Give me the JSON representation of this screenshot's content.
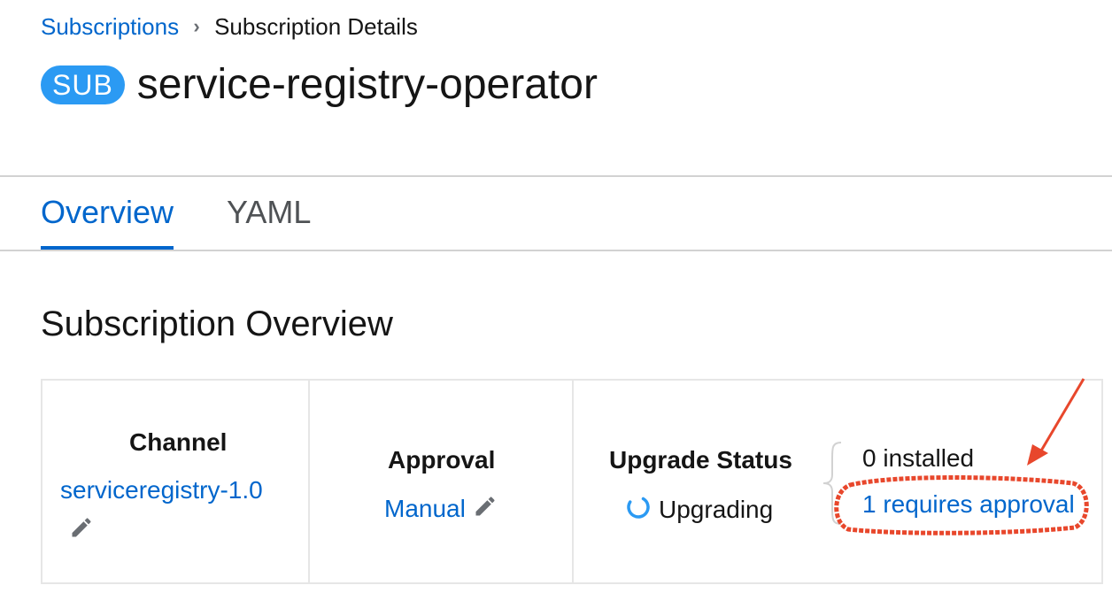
{
  "breadcrumb": {
    "parent": "Subscriptions",
    "current": "Subscription Details"
  },
  "header": {
    "badge": "SUB",
    "title": "service-registry-operator"
  },
  "tabs": [
    {
      "label": "Overview",
      "active": true
    },
    {
      "label": "YAML",
      "active": false
    }
  ],
  "section": {
    "title": "Subscription Overview"
  },
  "details": {
    "channel": {
      "label": "Channel",
      "value": "serviceregistry-1.0"
    },
    "approval": {
      "label": "Approval",
      "value": "Manual"
    },
    "upgrade": {
      "label": "Upgrade Status",
      "status": "Upgrading",
      "installed": "0 installed",
      "requires_approval": "1 requires approval"
    }
  },
  "colors": {
    "link": "#0066cc",
    "badge": "#2b9af3",
    "annotation": "#e8472c"
  }
}
